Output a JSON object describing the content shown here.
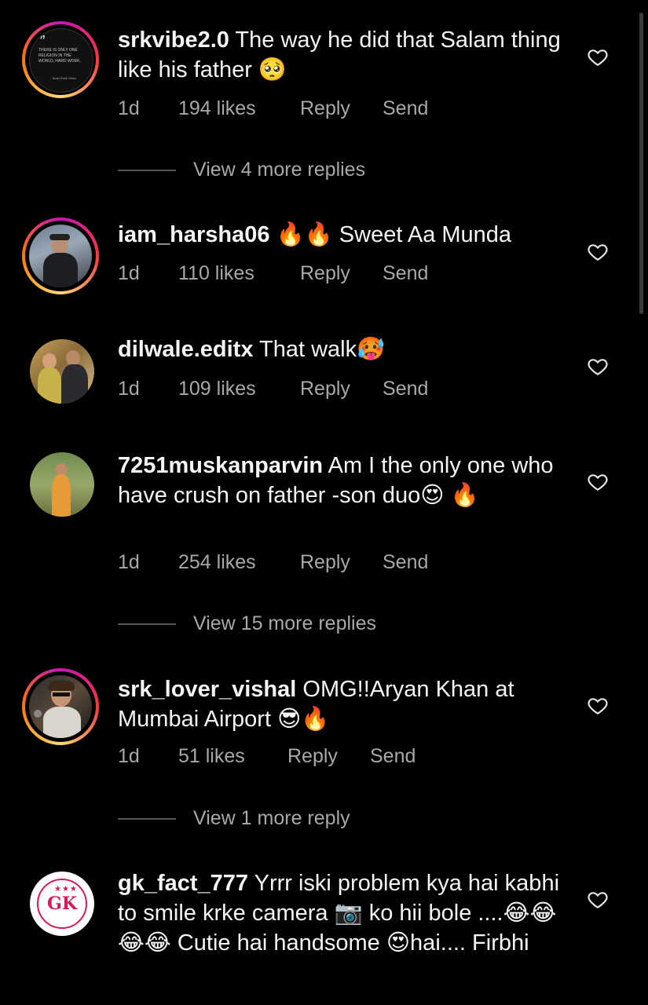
{
  "comments": [
    {
      "username": "srkvibe2.0",
      "text": " The way he did that Salam thing like his father 🥺",
      "time": "1d",
      "likes": "194 likes",
      "reply": "Reply",
      "send": "Send",
      "avatar_quote": "THERE IS ONLY ONE RELIGION IN THE WORLD, HARD WORK.",
      "avatar_author": "- Shah Rukh Khan",
      "view_replies": "View 4 more replies"
    },
    {
      "username": "iam_harsha06",
      "text": " 🔥🔥 Sweet Aa Munda",
      "time": "1d",
      "likes": "110 likes",
      "reply": "Reply",
      "send": "Send"
    },
    {
      "username": "dilwale.editx",
      "text": " That walk🥵",
      "time": "1d",
      "likes": "109 likes",
      "reply": "Reply",
      "send": "Send"
    },
    {
      "username": "7251muskanparvin",
      "text": " Am I the only one who have crush on father -son duo😍 🔥",
      "time": "1d",
      "likes": "254 likes",
      "reply": "Reply",
      "send": "Send",
      "view_replies": "View 15 more replies"
    },
    {
      "username": "srk_lover_vishal",
      "text": " OMG!!Aryan Khan at Mumbai Airport 😎🔥",
      "time": "1d",
      "likes": "51 likes",
      "reply": "Reply",
      "send": "Send",
      "view_replies": "View 1 more reply"
    },
    {
      "username": "gk_fact_777",
      "text": " Yrrr iski problem kya hai kabhi to smile krke camera 📷 ko hii bole ....😂😂😂😂 Cutie hai handsome 😍hai.... Firbhi",
      "avatar_text": "GK"
    }
  ],
  "colors": {
    "background": "#000000",
    "secondary_text": "#a8a8a8",
    "primary_text": "#f5f5f5"
  },
  "icons": {
    "like": "heart-outline-icon"
  }
}
